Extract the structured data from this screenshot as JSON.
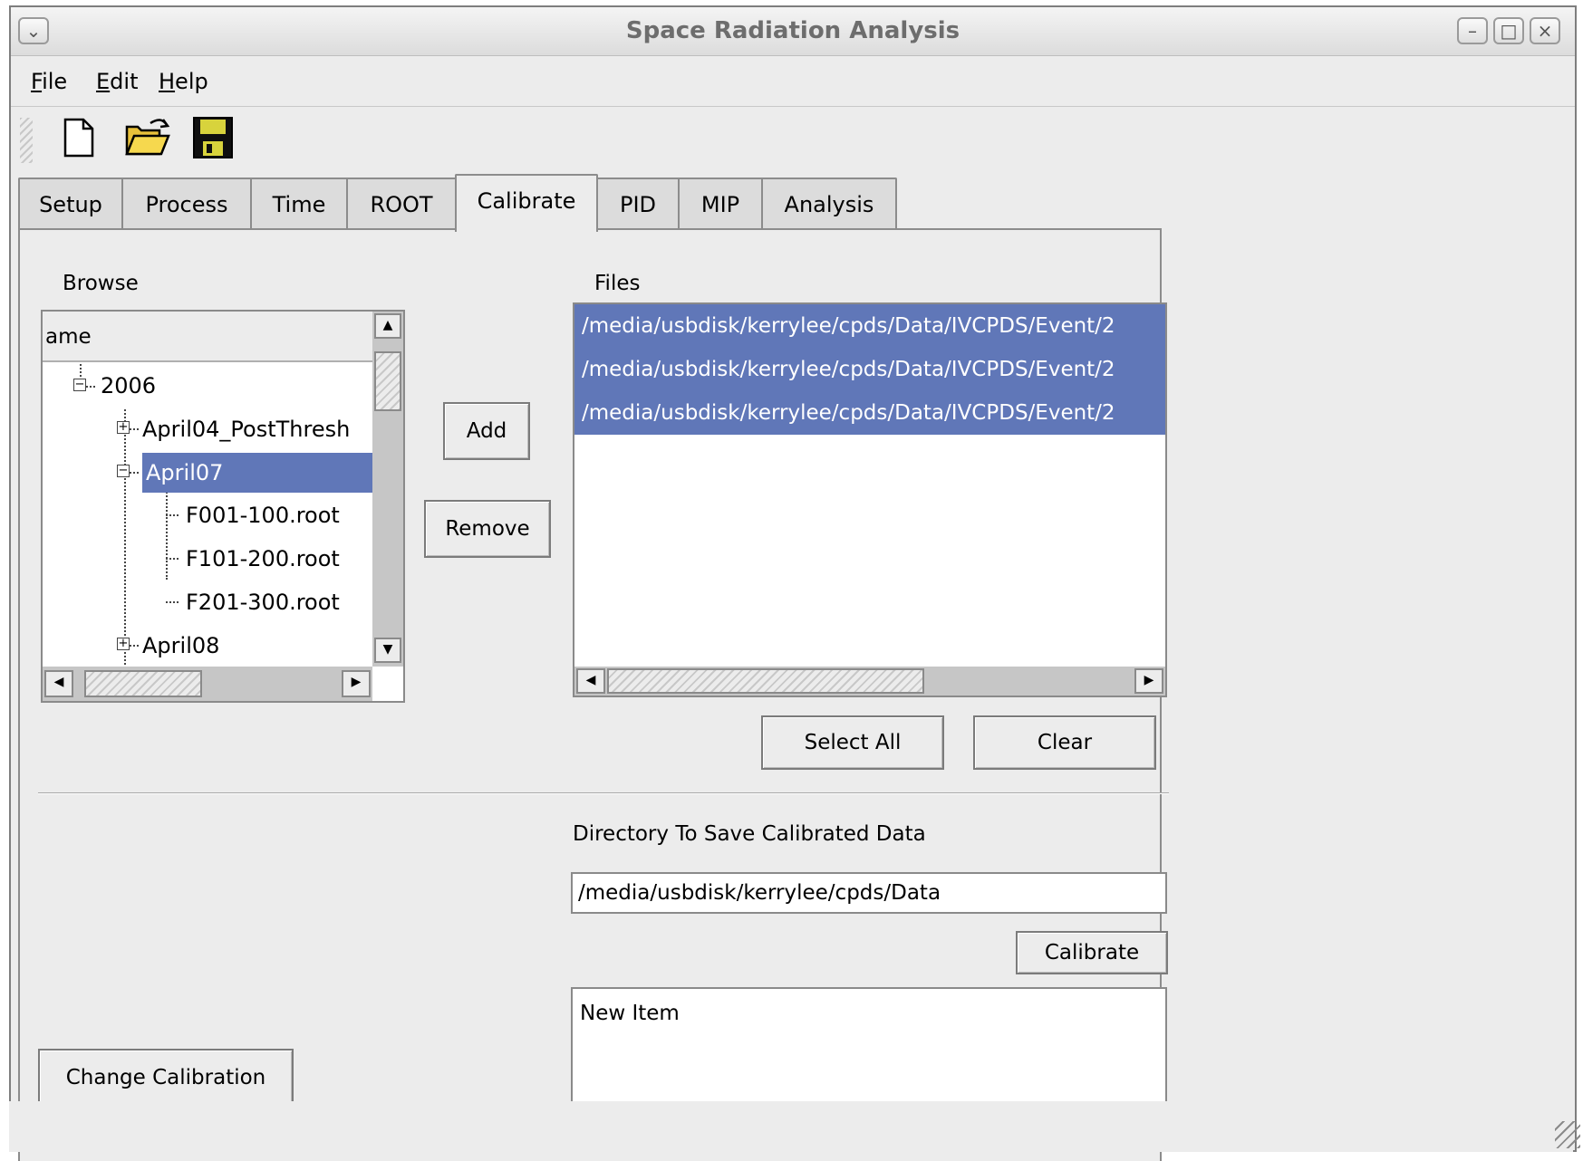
{
  "window": {
    "title": "Space Radiation Analysis",
    "controls": {
      "minimize": "–",
      "maximize": "□",
      "close": "×",
      "menu": "⌄"
    }
  },
  "menubar": [
    {
      "mnemonic": "F",
      "rest": "ile"
    },
    {
      "mnemonic": "E",
      "rest": "dit"
    },
    {
      "mnemonic": "H",
      "rest": "elp"
    }
  ],
  "toolbar": {
    "icons": [
      "new-document-icon",
      "open-folder-icon",
      "save-disk-icon"
    ]
  },
  "tabs": [
    "Setup",
    "Process",
    "Time",
    "ROOT",
    "Calibrate",
    "PID",
    "MIP",
    "Analysis"
  ],
  "active_tab": "Calibrate",
  "browse": {
    "label": "Browse",
    "column_header": "ame",
    "nodes": [
      {
        "label": "2006",
        "expander": "−"
      },
      {
        "label": "April04_PostThresh",
        "expander": "+"
      },
      {
        "label": "April07",
        "expander": "−",
        "selected": true
      },
      {
        "label": "F001-100.root"
      },
      {
        "label": "F101-200.root"
      },
      {
        "label": "F201-300.root"
      },
      {
        "label": "April08",
        "expander": "+"
      }
    ]
  },
  "buttons": {
    "add": "Add",
    "remove": "Remove",
    "select_all": "Select All",
    "clear": "Clear",
    "calibrate": "Calibrate",
    "change_calibration": "Change Calibration"
  },
  "files": {
    "label": "Files",
    "rows": [
      "/media/usbdisk/kerrylee/cpds/Data/IVCPDS/Event/2",
      "/media/usbdisk/kerrylee/cpds/Data/IVCPDS/Event/2",
      "/media/usbdisk/kerrylee/cpds/Data/IVCPDS/Event/2"
    ]
  },
  "save_dir": {
    "label": "Directory To Save Calibrated Data",
    "value": "/media/usbdisk/kerrylee/cpds/Data"
  },
  "output": {
    "text": "New Item"
  },
  "colors": {
    "selection": "#6077b8",
    "background": "#ececec"
  }
}
